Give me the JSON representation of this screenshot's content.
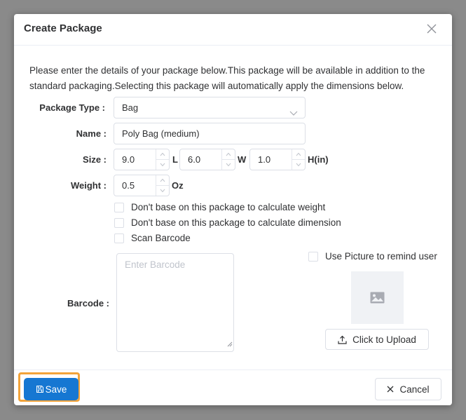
{
  "dialog": {
    "title": "Create Package",
    "intro": "Please enter the details of your package below.This package will be available in addition to the standard packaging.Selecting this package will automatically apply the dimensions below."
  },
  "form": {
    "package_type": {
      "label": "Package Type :",
      "value": "Bag"
    },
    "name": {
      "label": "Name :",
      "value": "Poly Bag (medium)"
    },
    "size": {
      "label": "Size :",
      "length": "9.0",
      "length_unit": "L",
      "width": "6.0",
      "width_unit": "W",
      "height": "1.0",
      "height_unit": "H(in)"
    },
    "weight": {
      "label": "Weight :",
      "value": "0.5",
      "unit": "Oz"
    },
    "checkboxes": {
      "no_weight": "Don't base on this package to calculate weight",
      "no_dimension": "Don't base on this package to calculate dimension",
      "scan_barcode": "Scan Barcode"
    },
    "barcode": {
      "label": "Barcode :",
      "placeholder": "Enter Barcode"
    },
    "picture": {
      "checkbox": "Use Picture to remind user",
      "upload_label": "Click to Upload"
    }
  },
  "footer": {
    "save_label": "Save",
    "cancel_label": "Cancel"
  },
  "colors": {
    "primary": "#1677d2",
    "highlight": "#f2a33a",
    "border": "#dcdfe6"
  },
  "icons": [
    "close-icon",
    "chevron-down-icon",
    "image-icon",
    "upload-icon",
    "save-icon"
  ]
}
